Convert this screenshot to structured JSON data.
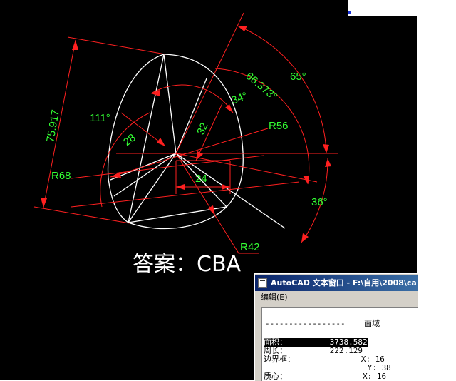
{
  "drawing": {
    "colors": {
      "background": "#000000",
      "geometry": "#ffffff",
      "dimension": "#ff2020",
      "dimtext": "#33ff33"
    },
    "dimensions": {
      "length_75917": "75.917",
      "angle_111": "111°",
      "length_28": "28",
      "length_32": "32",
      "angle_34": "34°",
      "angle_66373": "66.373°",
      "angle_65": "65°",
      "radius_56": "R56",
      "radius_68": "R68",
      "length_24": "24",
      "angle_36": "36°",
      "radius_42": "R42"
    },
    "answer_label": "答案：CBA"
  },
  "text_window": {
    "title": "AutoCAD 文本窗口 - F:\\自用\\2008\\ca",
    "menu": {
      "edit": "编辑(E)"
    },
    "lines": [
      {
        "key": "separator",
        "text": "-----------------    面域"
      },
      {
        "key": "area",
        "text": "面积：         3738.582"
      },
      {
        "key": "perimeter",
        "text": "周长：         222.129"
      },
      {
        "key": "bbox_label",
        "text": "边界框：              X: 16"
      },
      {
        "key": "bbox_y",
        "text": "                      Y: 38"
      },
      {
        "key": "centroid",
        "text": "质心：                X: 16"
      }
    ]
  }
}
